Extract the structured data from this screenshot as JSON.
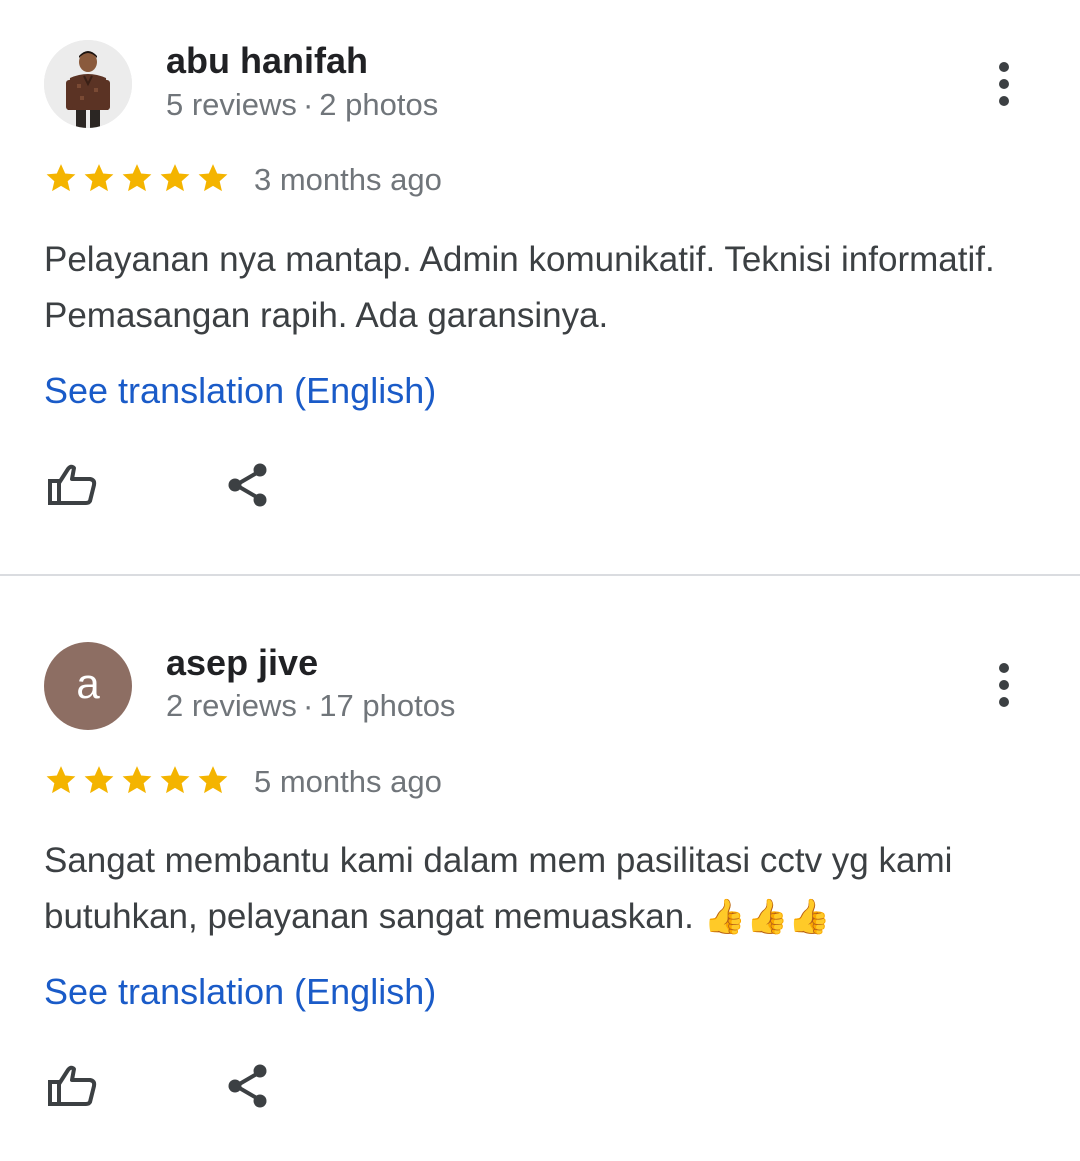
{
  "reviews": [
    {
      "reviewer_name": "abu hanifah",
      "reviews_count": "5 reviews",
      "separator": "·",
      "photos_count": "2 photos",
      "avatar": "profile-photo",
      "rating": 5,
      "rating_max": 5,
      "time_ago": "3 months ago",
      "text": "Pelayanan nya mantap. Admin komunikatif. Teknisi informatif. Pemasangan rapih. Ada garansinya.",
      "emoji": "",
      "translate_link": "See translation (English)",
      "actions": [
        "thumb-up-icon",
        "share-icon"
      ]
    },
    {
      "reviewer_name": "asep jive",
      "reviews_count": "2 reviews",
      "separator": "·",
      "photos_count": "17 photos",
      "avatar_letter": "a",
      "avatar_color": "#8d6e63",
      "rating": 5,
      "rating_max": 5,
      "time_ago": "5 months ago",
      "text": "Sangat membantu kami dalam mem pasilitasi cctv yg kami butuhkan, pelayanan sangat memuaskan.",
      "emoji": "👍👍👍",
      "translate_link": "See translation (English)",
      "actions": [
        "thumb-up-icon",
        "share-icon"
      ]
    }
  ],
  "colors": {
    "star": "#f4b400",
    "link": "#1a5bc8",
    "meta_text": "#70757a",
    "body_text": "#3c4043",
    "divider": "#dadce0"
  }
}
